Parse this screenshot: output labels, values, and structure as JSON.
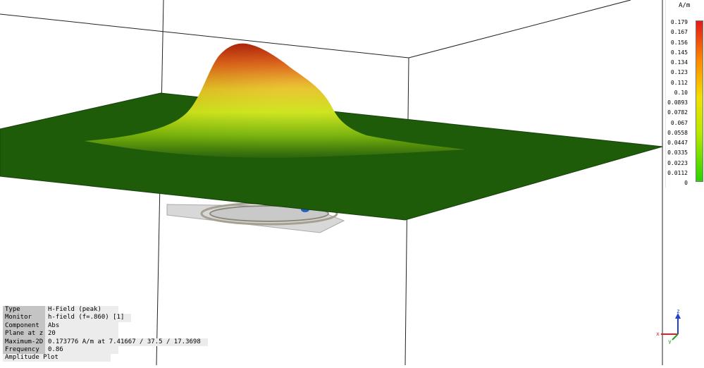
{
  "legend": {
    "unit": "A/m",
    "ticks": [
      "0.179",
      "0.167",
      "0.156",
      "0.145",
      "0.134",
      "0.123",
      "0.112",
      "0.10",
      "0.0893",
      "0.0782",
      "0.067",
      "0.0558",
      "0.0447",
      "0.0335",
      "0.0223",
      "0.0112",
      "0"
    ],
    "colors": {
      "max": "#e31a1a",
      "high": "#ff8a00",
      "mid": "#f2e000",
      "low": "#28d400"
    }
  },
  "info": {
    "rows": [
      {
        "key": "Type",
        "value": "H-Field (peak)"
      },
      {
        "key": "Monitor",
        "value": "h-field (f=.860) [1]"
      },
      {
        "key": "Component",
        "value": "Abs"
      },
      {
        "key": "Plane at z",
        "value": "20"
      },
      {
        "key": "Maximum-2D",
        "value": "0.173776 A/m at 7.41667 / 37.5 / 17.3698"
      },
      {
        "key": "Frequency",
        "value": "0.86"
      }
    ],
    "footer": "Amplitude Plot"
  },
  "triad": {
    "x_label": "x",
    "y_label": "y",
    "z_label": "z",
    "x_color": "#e02020",
    "y_color": "#20a020",
    "z_color": "#2040d0"
  },
  "scene": {
    "plane_color": "#1e5c0a",
    "background": "#ffffff"
  }
}
